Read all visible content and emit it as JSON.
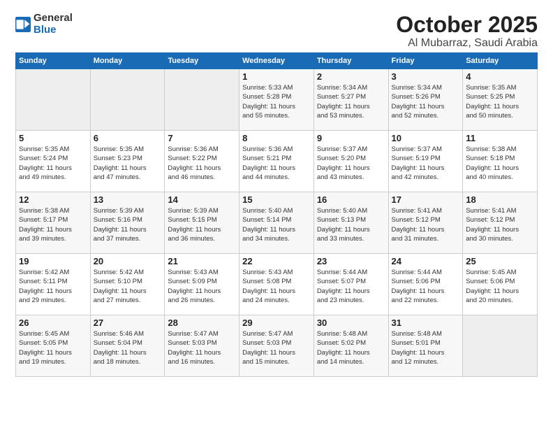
{
  "logo": {
    "general": "General",
    "blue": "Blue"
  },
  "title": "October 2025",
  "location": "Al Mubarraz, Saudi Arabia",
  "days_of_week": [
    "Sunday",
    "Monday",
    "Tuesday",
    "Wednesday",
    "Thursday",
    "Friday",
    "Saturday"
  ],
  "weeks": [
    [
      {
        "day": "",
        "info": ""
      },
      {
        "day": "",
        "info": ""
      },
      {
        "day": "",
        "info": ""
      },
      {
        "day": "1",
        "info": "Sunrise: 5:33 AM\nSunset: 5:28 PM\nDaylight: 11 hours\nand 55 minutes."
      },
      {
        "day": "2",
        "info": "Sunrise: 5:34 AM\nSunset: 5:27 PM\nDaylight: 11 hours\nand 53 minutes."
      },
      {
        "day": "3",
        "info": "Sunrise: 5:34 AM\nSunset: 5:26 PM\nDaylight: 11 hours\nand 52 minutes."
      },
      {
        "day": "4",
        "info": "Sunrise: 5:35 AM\nSunset: 5:25 PM\nDaylight: 11 hours\nand 50 minutes."
      }
    ],
    [
      {
        "day": "5",
        "info": "Sunrise: 5:35 AM\nSunset: 5:24 PM\nDaylight: 11 hours\nand 49 minutes."
      },
      {
        "day": "6",
        "info": "Sunrise: 5:35 AM\nSunset: 5:23 PM\nDaylight: 11 hours\nand 47 minutes."
      },
      {
        "day": "7",
        "info": "Sunrise: 5:36 AM\nSunset: 5:22 PM\nDaylight: 11 hours\nand 46 minutes."
      },
      {
        "day": "8",
        "info": "Sunrise: 5:36 AM\nSunset: 5:21 PM\nDaylight: 11 hours\nand 44 minutes."
      },
      {
        "day": "9",
        "info": "Sunrise: 5:37 AM\nSunset: 5:20 PM\nDaylight: 11 hours\nand 43 minutes."
      },
      {
        "day": "10",
        "info": "Sunrise: 5:37 AM\nSunset: 5:19 PM\nDaylight: 11 hours\nand 42 minutes."
      },
      {
        "day": "11",
        "info": "Sunrise: 5:38 AM\nSunset: 5:18 PM\nDaylight: 11 hours\nand 40 minutes."
      }
    ],
    [
      {
        "day": "12",
        "info": "Sunrise: 5:38 AM\nSunset: 5:17 PM\nDaylight: 11 hours\nand 39 minutes."
      },
      {
        "day": "13",
        "info": "Sunrise: 5:39 AM\nSunset: 5:16 PM\nDaylight: 11 hours\nand 37 minutes."
      },
      {
        "day": "14",
        "info": "Sunrise: 5:39 AM\nSunset: 5:15 PM\nDaylight: 11 hours\nand 36 minutes."
      },
      {
        "day": "15",
        "info": "Sunrise: 5:40 AM\nSunset: 5:14 PM\nDaylight: 11 hours\nand 34 minutes."
      },
      {
        "day": "16",
        "info": "Sunrise: 5:40 AM\nSunset: 5:13 PM\nDaylight: 11 hours\nand 33 minutes."
      },
      {
        "day": "17",
        "info": "Sunrise: 5:41 AM\nSunset: 5:12 PM\nDaylight: 11 hours\nand 31 minutes."
      },
      {
        "day": "18",
        "info": "Sunrise: 5:41 AM\nSunset: 5:12 PM\nDaylight: 11 hours\nand 30 minutes."
      }
    ],
    [
      {
        "day": "19",
        "info": "Sunrise: 5:42 AM\nSunset: 5:11 PM\nDaylight: 11 hours\nand 29 minutes."
      },
      {
        "day": "20",
        "info": "Sunrise: 5:42 AM\nSunset: 5:10 PM\nDaylight: 11 hours\nand 27 minutes."
      },
      {
        "day": "21",
        "info": "Sunrise: 5:43 AM\nSunset: 5:09 PM\nDaylight: 11 hours\nand 26 minutes."
      },
      {
        "day": "22",
        "info": "Sunrise: 5:43 AM\nSunset: 5:08 PM\nDaylight: 11 hours\nand 24 minutes."
      },
      {
        "day": "23",
        "info": "Sunrise: 5:44 AM\nSunset: 5:07 PM\nDaylight: 11 hours\nand 23 minutes."
      },
      {
        "day": "24",
        "info": "Sunrise: 5:44 AM\nSunset: 5:06 PM\nDaylight: 11 hours\nand 22 minutes."
      },
      {
        "day": "25",
        "info": "Sunrise: 5:45 AM\nSunset: 5:06 PM\nDaylight: 11 hours\nand 20 minutes."
      }
    ],
    [
      {
        "day": "26",
        "info": "Sunrise: 5:45 AM\nSunset: 5:05 PM\nDaylight: 11 hours\nand 19 minutes."
      },
      {
        "day": "27",
        "info": "Sunrise: 5:46 AM\nSunset: 5:04 PM\nDaylight: 11 hours\nand 18 minutes."
      },
      {
        "day": "28",
        "info": "Sunrise: 5:47 AM\nSunset: 5:03 PM\nDaylight: 11 hours\nand 16 minutes."
      },
      {
        "day": "29",
        "info": "Sunrise: 5:47 AM\nSunset: 5:03 PM\nDaylight: 11 hours\nand 15 minutes."
      },
      {
        "day": "30",
        "info": "Sunrise: 5:48 AM\nSunset: 5:02 PM\nDaylight: 11 hours\nand 14 minutes."
      },
      {
        "day": "31",
        "info": "Sunrise: 5:48 AM\nSunset: 5:01 PM\nDaylight: 11 hours\nand 12 minutes."
      },
      {
        "day": "",
        "info": ""
      }
    ]
  ]
}
